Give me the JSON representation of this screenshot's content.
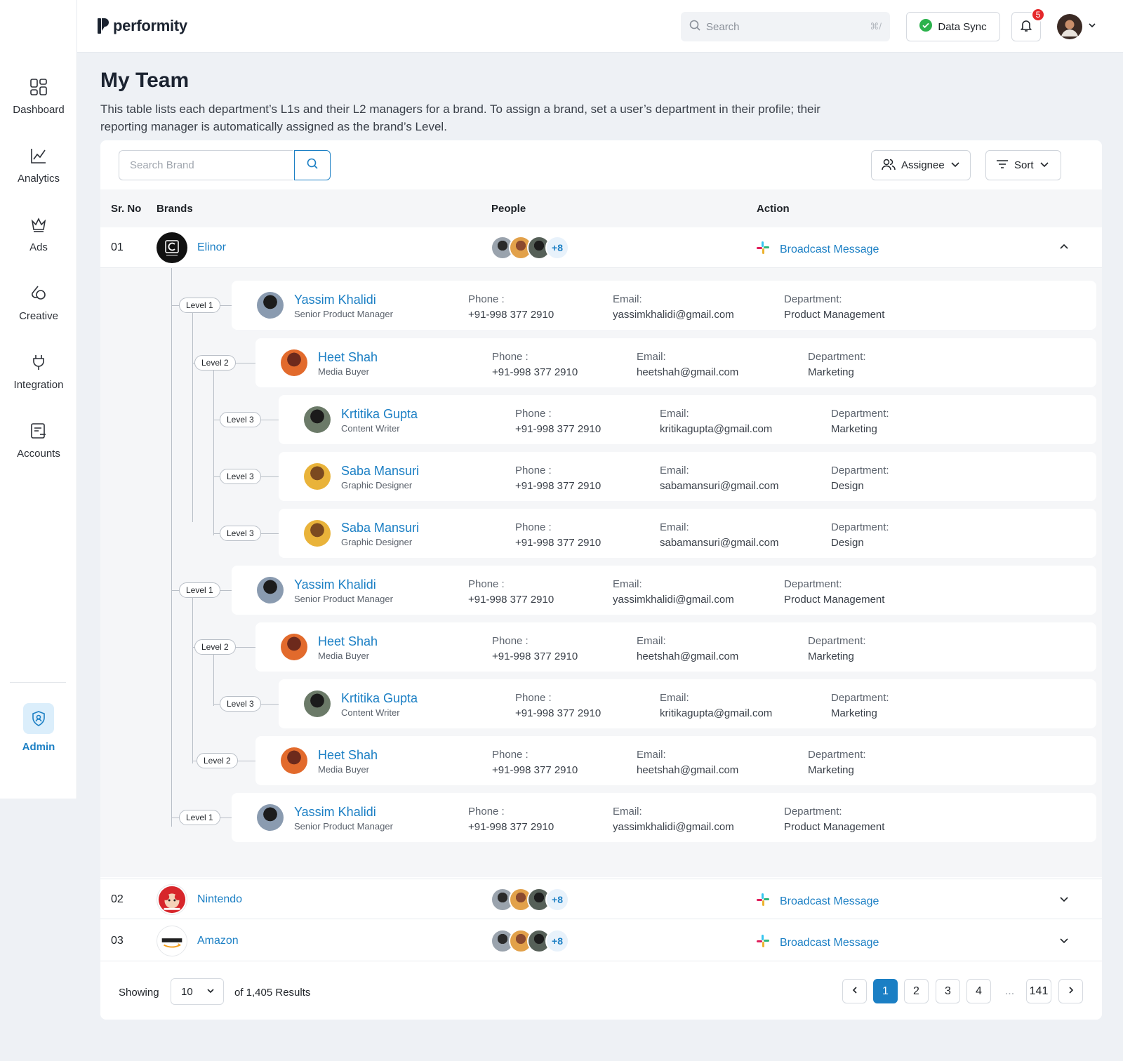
{
  "app": {
    "logo_text": "performity"
  },
  "sidebar": {
    "items": [
      {
        "label": "Dashboard",
        "icon": "dashboard-icon"
      },
      {
        "label": "Analytics",
        "icon": "analytics-icon"
      },
      {
        "label": "Ads",
        "icon": "crown-icon"
      },
      {
        "label": "Creative",
        "icon": "creative-icon"
      },
      {
        "label": "Integration",
        "icon": "plug-icon"
      },
      {
        "label": "Accounts",
        "icon": "accounts-icon"
      }
    ],
    "admin": {
      "label": "Admin",
      "icon": "shield-user-icon"
    }
  },
  "header": {
    "search_placeholder": "Search",
    "search_shortcut": "⌘/",
    "sync_label": "Data Sync",
    "notification_count": "5"
  },
  "page": {
    "title": "My Team",
    "description": "This table lists each department’s L1s and their L2 managers for a brand. To assign a brand, set a user’s department in their profile; their reporting manager is automatically assigned as the brand’s Level."
  },
  "toolbar": {
    "brand_search_placeholder": "Search Brand",
    "assignee_label": "Assignee",
    "sort_label": "Sort"
  },
  "table": {
    "columns": [
      "Sr. No",
      "Brands",
      "People",
      "Action"
    ],
    "rows": [
      {
        "sr": "01",
        "brand": "Elinor",
        "more_count": "+8",
        "action": "Broadcast Message",
        "expanded": true
      },
      {
        "sr": "02",
        "brand": "Nintendo",
        "more_count": "+8",
        "action": "Broadcast Message",
        "expanded": false
      },
      {
        "sr": "03",
        "brand": "Amazon",
        "more_count": "+8",
        "action": "Broadcast Message",
        "expanded": false
      }
    ]
  },
  "field_labels": {
    "phone": "Phone :",
    "email": "Email:",
    "department": "Department:"
  },
  "team": [
    {
      "level": "Level 1",
      "name": "Yassim Khalidi",
      "role": "Senior Product Manager",
      "phone": "+91-998 377 2910",
      "email": "yassimkhalidi@gmail.com",
      "department": "Product Management"
    },
    {
      "level": "Level 2",
      "name": "Heet Shah",
      "role": "Media Buyer",
      "phone": "+91-998 377 2910",
      "email": "heetshah@gmail.com",
      "department": "Marketing"
    },
    {
      "level": "Level 3",
      "name": "Krtitika Gupta",
      "role": "Content Writer",
      "phone": "+91-998 377 2910",
      "email": "kritikagupta@gmail.com",
      "department": "Marketing"
    },
    {
      "level": "Level 3",
      "name": "Saba Mansuri",
      "role": "Graphic Designer",
      "phone": "+91-998 377 2910",
      "email": "sabamansuri@gmail.com",
      "department": "Design"
    },
    {
      "level": "Level 3",
      "name": "Saba Mansuri",
      "role": "Graphic Designer",
      "phone": "+91-998 377 2910",
      "email": "sabamansuri@gmail.com",
      "department": "Design"
    },
    {
      "level": "Level 1",
      "name": "Yassim Khalidi",
      "role": "Senior Product Manager",
      "phone": "+91-998 377 2910",
      "email": "yassimkhalidi@gmail.com",
      "department": "Product Management"
    },
    {
      "level": "Level 2",
      "name": "Heet Shah",
      "role": "Media Buyer",
      "phone": "+91-998 377 2910",
      "email": "heetshah@gmail.com",
      "department": "Marketing"
    },
    {
      "level": "Level 3",
      "name": "Krtitika Gupta",
      "role": "Content Writer",
      "phone": "+91-998 377 2910",
      "email": "kritikagupta@gmail.com",
      "department": "Marketing"
    },
    {
      "level": "Level 2",
      "name": "Heet Shah",
      "role": "Media Buyer",
      "phone": "+91-998 377 2910",
      "email": "heetshah@gmail.com",
      "department": "Marketing"
    },
    {
      "level": "Level 1",
      "name": "Yassim Khalidi",
      "role": "Senior Product Manager",
      "phone": "+91-998 377 2910",
      "email": "yassimkhalidi@gmail.com",
      "department": "Product Management"
    }
  ],
  "pagination": {
    "showing_label": "Showing",
    "per_page": "10",
    "results_label": "of 1,405 Results",
    "pages": [
      "1",
      "2",
      "3",
      "4"
    ],
    "ellipsis": "...",
    "last_page": "141",
    "current": "1"
  },
  "colors": {
    "accent": "#1b7fc4",
    "badge": "#e5282b",
    "sync_ok": "#2bb24c"
  }
}
